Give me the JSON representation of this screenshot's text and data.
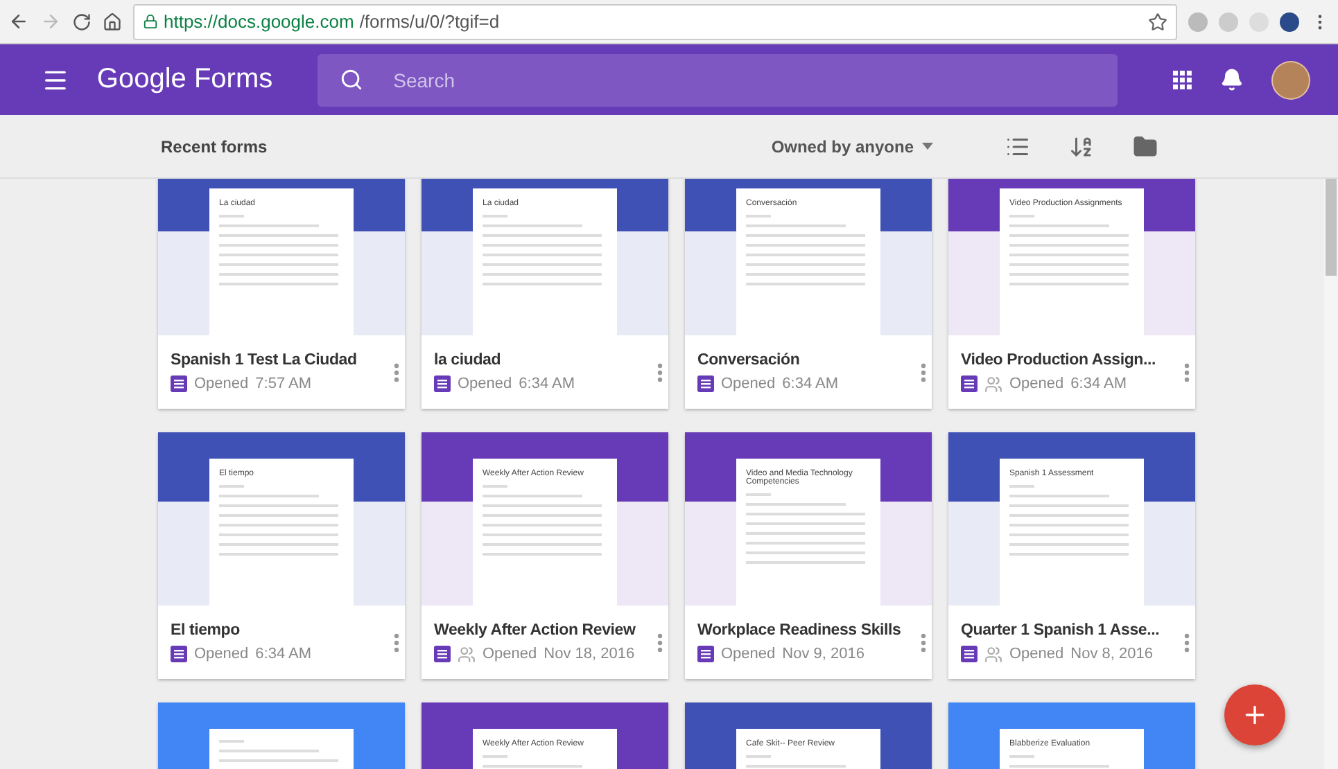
{
  "browser": {
    "url_host": "https://docs.google.com",
    "url_path": "/forms/u/0/?tgif=d"
  },
  "app_bar": {
    "logo_word_1": "Google",
    "logo_word_2": "Forms",
    "search": {
      "placeholder": "Search"
    }
  },
  "toolbar": {
    "title": "Recent forms",
    "owner_filter": "Owned by anyone"
  },
  "forms": [
    {
      "color": "#3f51b5",
      "preview_title": "La ciudad",
      "title": "Spanish 1 Test La Ciudad",
      "opened_label": "Opened",
      "opened_time": "7:57 AM"
    },
    {
      "color": "#3f51b5",
      "preview_title": "La ciudad",
      "title": "la ciudad",
      "opened_label": "Opened",
      "opened_time": "6:34 AM"
    },
    {
      "color": "#3f51b5",
      "preview_title": "Conversación",
      "title": "Conversación",
      "opened_label": "Opened",
      "opened_time": "6:34 AM"
    },
    {
      "color": "#673ab7",
      "preview_title": "Video Production Assignments",
      "title": "Video Production Assign...",
      "shared": true,
      "opened_label": "Opened",
      "opened_time": "6:34 AM"
    },
    {
      "color": "#3f51b5",
      "preview_title": "El tiempo",
      "title": "El tiempo",
      "opened_label": "Opened",
      "opened_time": "6:34 AM"
    },
    {
      "color": "#673ab7",
      "preview_title": "Weekly After Action Review",
      "title": "Weekly After Action Review",
      "shared": true,
      "opened_label": "Opened",
      "opened_time": "Nov 18, 2016"
    },
    {
      "color": "#673ab7",
      "preview_title": "Video and Media Technology Competencies",
      "title": "Workplace Readiness Skills",
      "opened_label": "Opened",
      "opened_time": "Nov 9, 2016"
    },
    {
      "color": "#3f51b5",
      "preview_title": "Spanish 1 Assessment",
      "title": "Quarter 1 Spanish 1 Asse...",
      "shared": true,
      "opened_label": "Opened",
      "opened_time": "Nov 8, 2016"
    },
    {
      "color": "#4285f4"
    },
    {
      "color": "#673ab7",
      "preview_title": "Weekly After Action Review"
    },
    {
      "color": "#3f51b5",
      "preview_title": "Cafe Skit-- Peer Review"
    },
    {
      "color": "#4285f4",
      "preview_title": "Blabberize Evaluation"
    }
  ]
}
